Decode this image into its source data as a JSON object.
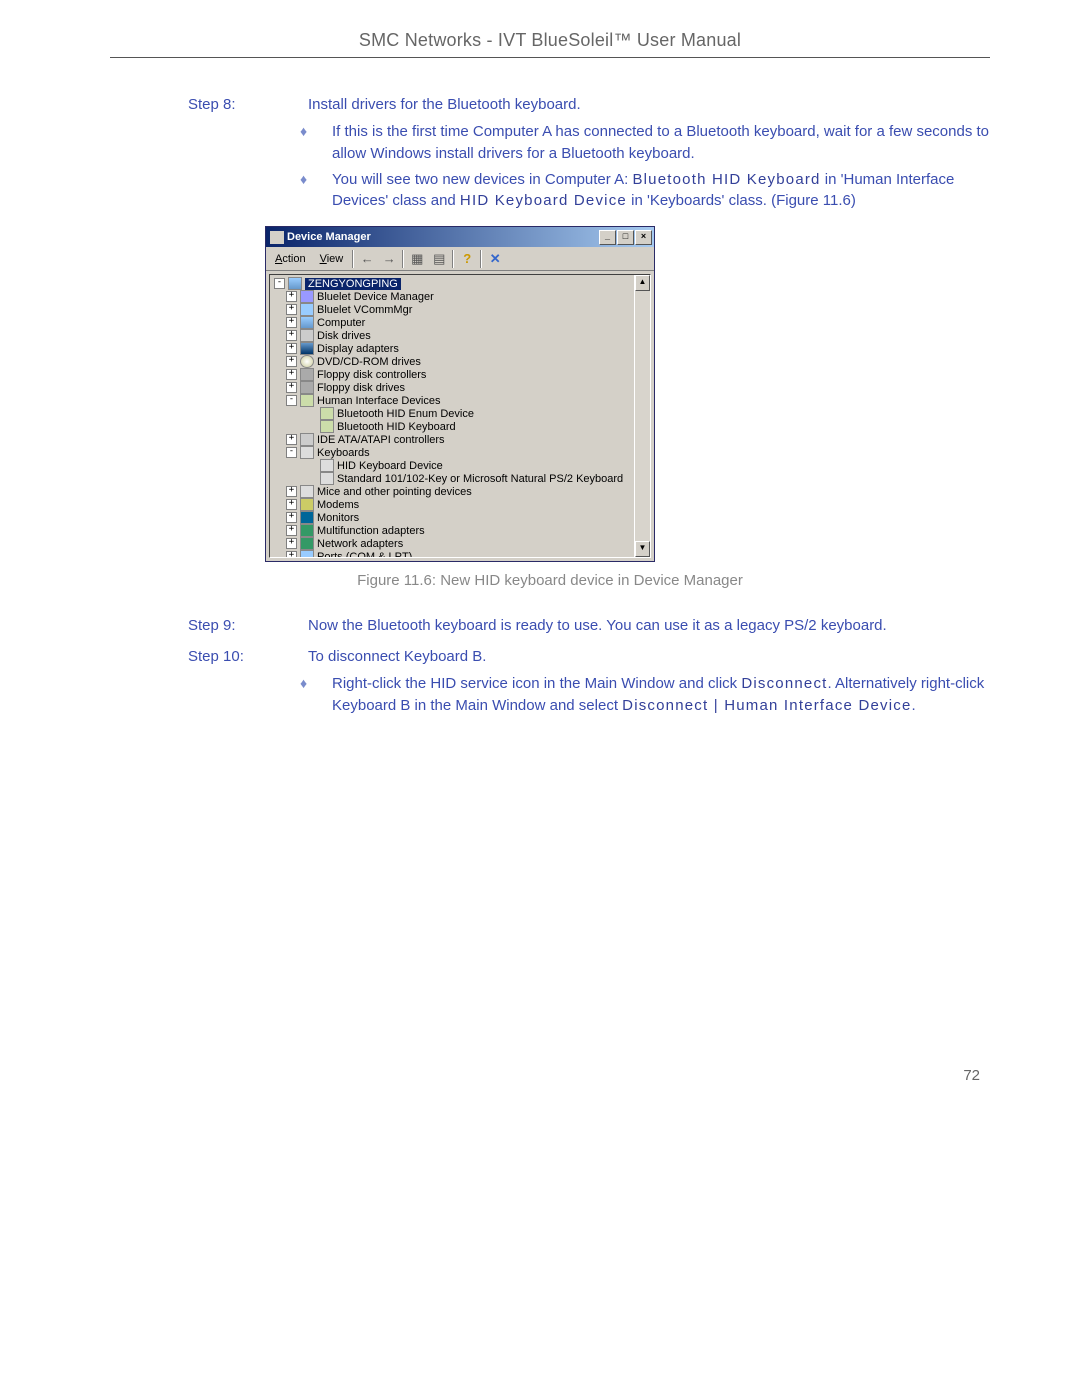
{
  "header": "SMC Networks - IVT BlueSoleil™ User Manual",
  "page_number": "72",
  "steps": {
    "s8": {
      "label": "Step 8:",
      "title": "Install drivers for the Bluetooth keyboard.",
      "bullets": [
        {
          "text": "If this is the first time Computer A has connected to a Bluetooth keyboard, wait for a few seconds to allow Windows install drivers for a Bluetooth keyboard."
        },
        {
          "text_parts": {
            "a": "You will see two new devices in Computer A: ",
            "term1": "Bluetooth HID Keyboard",
            "b": " in 'Human Interface Devices' class and ",
            "term2": "HID Keyboard Device",
            "c": " in 'Keyboards' class. (Figure 11.6)"
          }
        }
      ]
    },
    "s9": {
      "label": "Step 9:",
      "title": "Now the Bluetooth keyboard is ready to use. You can use it as a legacy PS/2 keyboard."
    },
    "s10": {
      "label": "Step 10:",
      "title": "To disconnect Keyboard B.",
      "bullets": [
        {
          "text_parts": {
            "a": "Right-click the HID service icon in the Main Window and click ",
            "term1": "Disconnect",
            "b": ". Alternatively right-click Keyboard B in the Main Window and select ",
            "term2": "Disconnect | Human Interface Device",
            "c": "."
          }
        }
      ]
    }
  },
  "figure_caption": "Figure 11.6: New HID keyboard device in Device Manager",
  "device_manager": {
    "title": "Device Manager",
    "menus": {
      "action": "Action",
      "view": "View"
    },
    "win_buttons": {
      "min": "_",
      "max": "□",
      "close": "×"
    },
    "toolbar": {
      "back": "←",
      "forward": "→",
      "prop": "▦",
      "refresh": "▤",
      "help": "?",
      "remove": "✕"
    },
    "root": "ZENGYONGPING",
    "nodes": [
      {
        "exp": "+",
        "ind": 1,
        "icon": "mgr",
        "label": "Bluelet Device Manager"
      },
      {
        "exp": "+",
        "ind": 1,
        "icon": "port",
        "label": "Bluelet VCommMgr"
      },
      {
        "exp": "+",
        "ind": 1,
        "icon": "computer",
        "label": "Computer"
      },
      {
        "exp": "+",
        "ind": 1,
        "icon": "disk",
        "label": "Disk drives"
      },
      {
        "exp": "+",
        "ind": 1,
        "icon": "display",
        "label": "Display adapters"
      },
      {
        "exp": "+",
        "ind": 1,
        "icon": "cd",
        "label": "DVD/CD-ROM drives"
      },
      {
        "exp": "+",
        "ind": 1,
        "icon": "floppy",
        "label": "Floppy disk controllers"
      },
      {
        "exp": "+",
        "ind": 1,
        "icon": "floppy",
        "label": "Floppy disk drives"
      },
      {
        "exp": "-",
        "ind": 1,
        "icon": "hid",
        "label": "Human Interface Devices"
      },
      {
        "exp": "",
        "ind": 2,
        "icon": "hid",
        "label": "Bluetooth HID Enum Device"
      },
      {
        "exp": "",
        "ind": 2,
        "icon": "hid",
        "label": "Bluetooth HID Keyboard"
      },
      {
        "exp": "+",
        "ind": 1,
        "icon": "ide",
        "label": "IDE ATA/ATAPI controllers"
      },
      {
        "exp": "-",
        "ind": 1,
        "icon": "kbd",
        "label": "Keyboards"
      },
      {
        "exp": "",
        "ind": 2,
        "icon": "kbd",
        "label": "HID Keyboard Device"
      },
      {
        "exp": "",
        "ind": 2,
        "icon": "kbd",
        "label": "Standard 101/102-Key or Microsoft Natural PS/2 Keyboard"
      },
      {
        "exp": "+",
        "ind": 1,
        "icon": "mouse",
        "label": "Mice and other pointing devices"
      },
      {
        "exp": "+",
        "ind": 1,
        "icon": "modem",
        "label": "Modems"
      },
      {
        "exp": "+",
        "ind": 1,
        "icon": "monitor",
        "label": "Monitors"
      },
      {
        "exp": "+",
        "ind": 1,
        "icon": "net",
        "label": "Multifunction adapters"
      },
      {
        "exp": "+",
        "ind": 1,
        "icon": "net",
        "label": "Network adapters"
      },
      {
        "exp": "+",
        "ind": 1,
        "icon": "port",
        "label": "Ports (COM & LPT)"
      }
    ]
  }
}
